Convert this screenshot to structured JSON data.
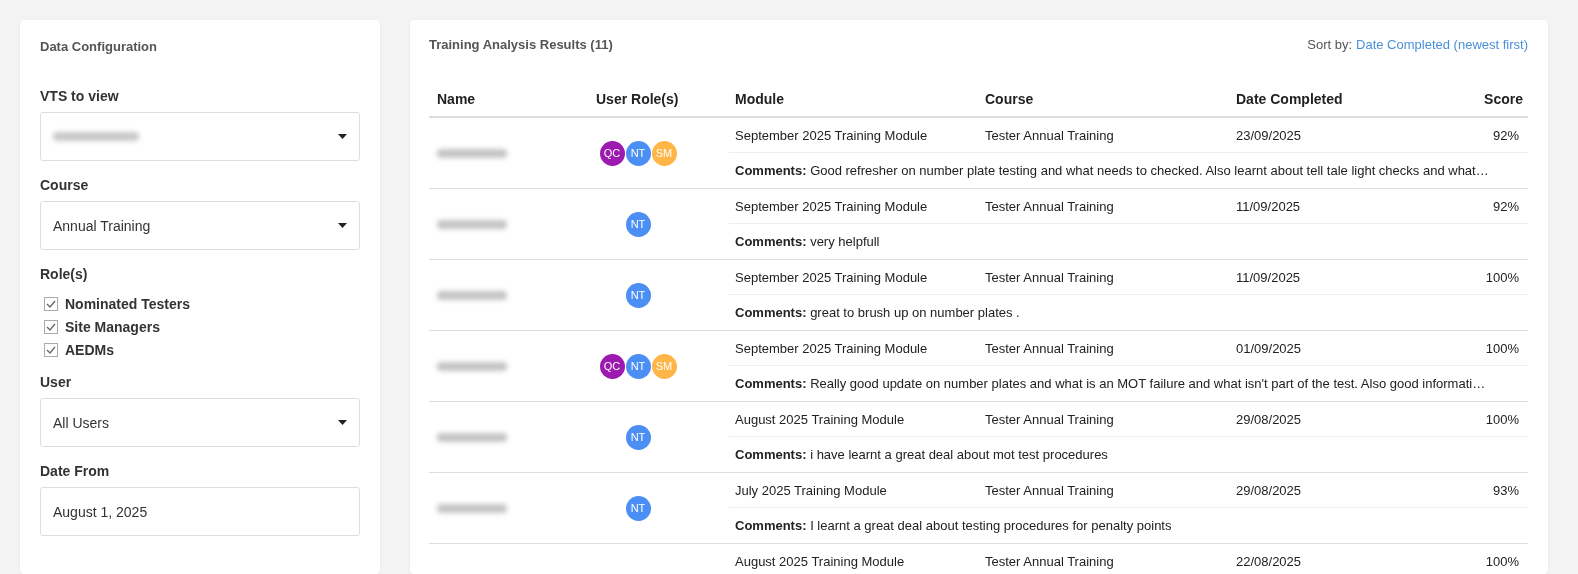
{
  "config": {
    "title": "Data Configuration",
    "fields": [
      {
        "kind": "select",
        "label": "VTS to view",
        "value_hidden": true
      },
      {
        "kind": "select",
        "label": "Course",
        "value": "Annual Training"
      },
      {
        "kind": "checks",
        "label": "Role(s)",
        "options": [
          {
            "label": "Nominated Testers",
            "checked": true
          },
          {
            "label": "Site Managers",
            "checked": true
          },
          {
            "label": "AEDMs",
            "checked": true
          }
        ]
      },
      {
        "kind": "select",
        "label": "User",
        "value": "All Users"
      },
      {
        "kind": "input",
        "label": "Date From",
        "value": "August 1, 2025"
      }
    ]
  },
  "results": {
    "title": "Training Analysis Results (11)",
    "sort_label": "Sort by:",
    "sort_value": "Date Completed (newest first)",
    "columns": [
      "Name",
      "User Role(s)",
      "Module",
      "Course",
      "Date Completed",
      "Score"
    ],
    "rows": [
      {
        "name_hidden": true,
        "roles": [
          {
            "label": "QC",
            "color": "#9c1aaf"
          },
          {
            "label": "NT",
            "color": "#4b8ef4"
          },
          {
            "label": "SM",
            "color": "#ffb548"
          }
        ],
        "module": "September 2025 Training Module",
        "course": "Tester Annual Training",
        "date": "23/09/2025",
        "score": "92%",
        "comment": "**Comments:** Good refresher on number plate testing and what needs to checked. Also learnt about tell tale light checks and what…"
      },
      {
        "name_hidden": true,
        "roles": [
          {
            "label": "NT",
            "color": "#4b8ef4"
          }
        ],
        "module": "September 2025 Training Module",
        "course": "Tester Annual Training",
        "date": "11/09/2025",
        "score": "92%",
        "comment": "**Comments:** very helpfull"
      },
      {
        "name_hidden": true,
        "roles": [
          {
            "label": "NT",
            "color": "#4b8ef4"
          }
        ],
        "module": "September 2025 Training Module",
        "course": "Tester Annual Training",
        "date": "11/09/2025",
        "score": "100%",
        "comment": "**Comments:** great to brush up on number plates ."
      },
      {
        "name_hidden": true,
        "roles": [
          {
            "label": "QC",
            "color": "#9c1aaf"
          },
          {
            "label": "NT",
            "color": "#4b8ef4"
          },
          {
            "label": "SM",
            "color": "#ffb548"
          }
        ],
        "module": "September 2025 Training Module",
        "course": "Tester Annual Training",
        "date": "01/09/2025",
        "score": "100%",
        "comment": "**Comments:** Really good update on number plates and what is an MOT failure and what isn't part of the test. Also good informati…"
      },
      {
        "name_hidden": true,
        "roles": [
          {
            "label": "NT",
            "color": "#4b8ef4"
          }
        ],
        "module": "August 2025 Training Module",
        "course": "Tester Annual Training",
        "date": "29/08/2025",
        "score": "100%",
        "comment": "**Comments:** i have learnt a great deal about mot test procedures"
      },
      {
        "name_hidden": true,
        "roles": [
          {
            "label": "NT",
            "color": "#4b8ef4"
          }
        ],
        "module": "July 2025 Training Module",
        "course": "Tester Annual Training",
        "date": "29/08/2025",
        "score": "93%",
        "comment": "**Comments:** I learnt a great deal about testing procedures for penalty points"
      },
      {
        "module": "August 2025 Training Module",
        "course": "Tester Annual Training",
        "date": "22/08/2025",
        "score": "100%"
      }
    ]
  }
}
